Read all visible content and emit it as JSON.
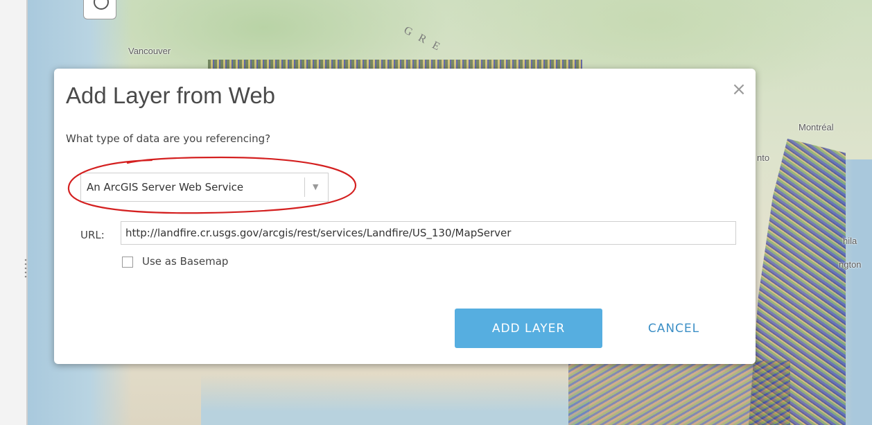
{
  "map": {
    "labels": {
      "vancouver": "Vancouver",
      "montreal": "Montréal",
      "toronto_partial": "nto",
      "philadelphia_partial": "hila",
      "washington_partial": "ngton",
      "region_partial": "G R E"
    }
  },
  "dialog": {
    "title": "Add Layer from Web",
    "close_icon": "close-icon",
    "question": "What type of data are you referencing?",
    "data_type": {
      "selected": "An ArcGIS Server Web Service"
    },
    "url": {
      "label": "URL:",
      "value": "http://landfire.cr.usgs.gov/arcgis/rest/services/Landfire/US_130/MapServer"
    },
    "basemap_checkbox": {
      "label": "Use as Basemap",
      "checked": false
    },
    "add_button": "ADD LAYER",
    "cancel_button": "CANCEL"
  },
  "colors": {
    "primary_button": "#56aee0",
    "link_button": "#3c8fc6",
    "annotation": "#d42020"
  }
}
